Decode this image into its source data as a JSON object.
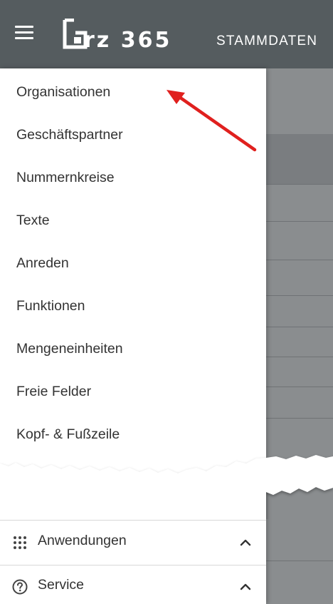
{
  "header": {
    "logo_text": "rz 365",
    "section_title": "STAMMDATEN",
    "menu_icon": "hamburger-menu-icon",
    "background_color": "#555c5f"
  },
  "drawer": {
    "items": [
      {
        "label": "Organisationen"
      },
      {
        "label": "Geschäftspartner"
      },
      {
        "label": "Nummernkreise"
      },
      {
        "label": "Texte"
      },
      {
        "label": "Anreden"
      },
      {
        "label": "Funktionen"
      },
      {
        "label": "Mengeneinheiten"
      },
      {
        "label": "Freie Felder"
      },
      {
        "label": "Kopf- & Fußzeile"
      }
    ],
    "footer": [
      {
        "label": "Anwendungen",
        "icon": "apps-grid-icon",
        "chevron": "chevron-up-icon"
      },
      {
        "label": "Service",
        "icon": "help-circle-icon",
        "chevron": "chevron-up-icon"
      }
    ]
  },
  "annotation": {
    "icon": "red-arrow-icon",
    "color": "#e0201e"
  }
}
